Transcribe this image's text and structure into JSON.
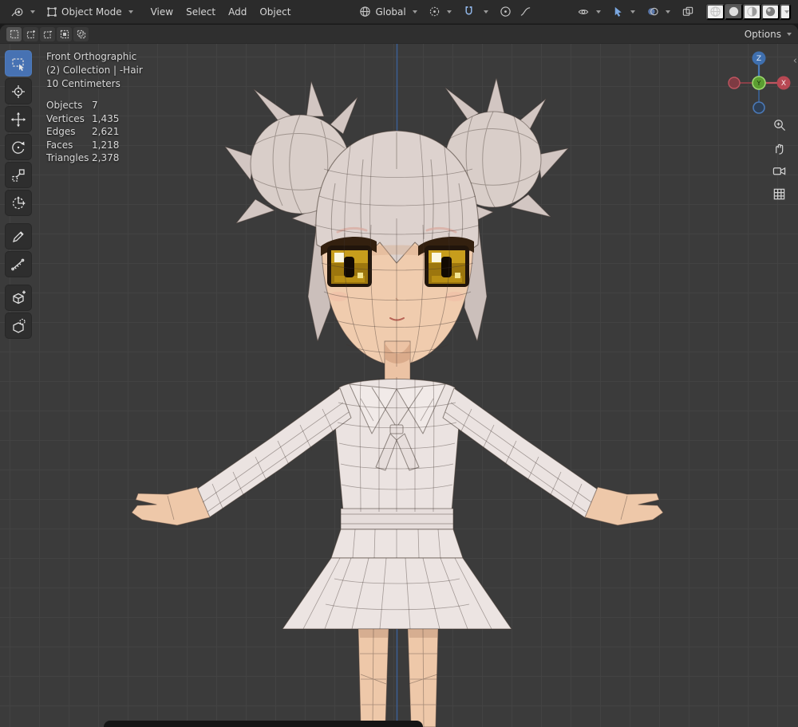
{
  "header": {
    "mode_label": "Object Mode",
    "menus": [
      "View",
      "Select",
      "Add",
      "Object"
    ],
    "orientation_label": "Global"
  },
  "tool_settings": {
    "options_label": "Options"
  },
  "overlay": {
    "view": "Front Orthographic",
    "collection": "(2) Collection | -Hair",
    "unit": "10 Centimeters",
    "stats": [
      {
        "label": "Objects",
        "value": "7"
      },
      {
        "label": "Vertices",
        "value": "1,435"
      },
      {
        "label": "Edges",
        "value": "2,621"
      },
      {
        "label": "Faces",
        "value": "1,218"
      },
      {
        "label": "Triangles",
        "value": "2,378"
      }
    ]
  },
  "gizmo": {
    "z": "Z",
    "x": "X",
    "y": "Y"
  },
  "sidebar_toggle": "‹",
  "colors": {
    "accent": "#4772b3",
    "axis_z": "#3d5f94",
    "viewport_bg": "#3b3b3b",
    "grid_line": "#434343",
    "eye_gold": "#c79d1c",
    "hair": "#d9cec9",
    "skin": "#f0ccae",
    "cloth": "#ebe3e1"
  },
  "icons": {
    "snap": "magnet",
    "orientation": "globe",
    "pivot": "circle-dot",
    "shading_active": "solid-sphere"
  }
}
